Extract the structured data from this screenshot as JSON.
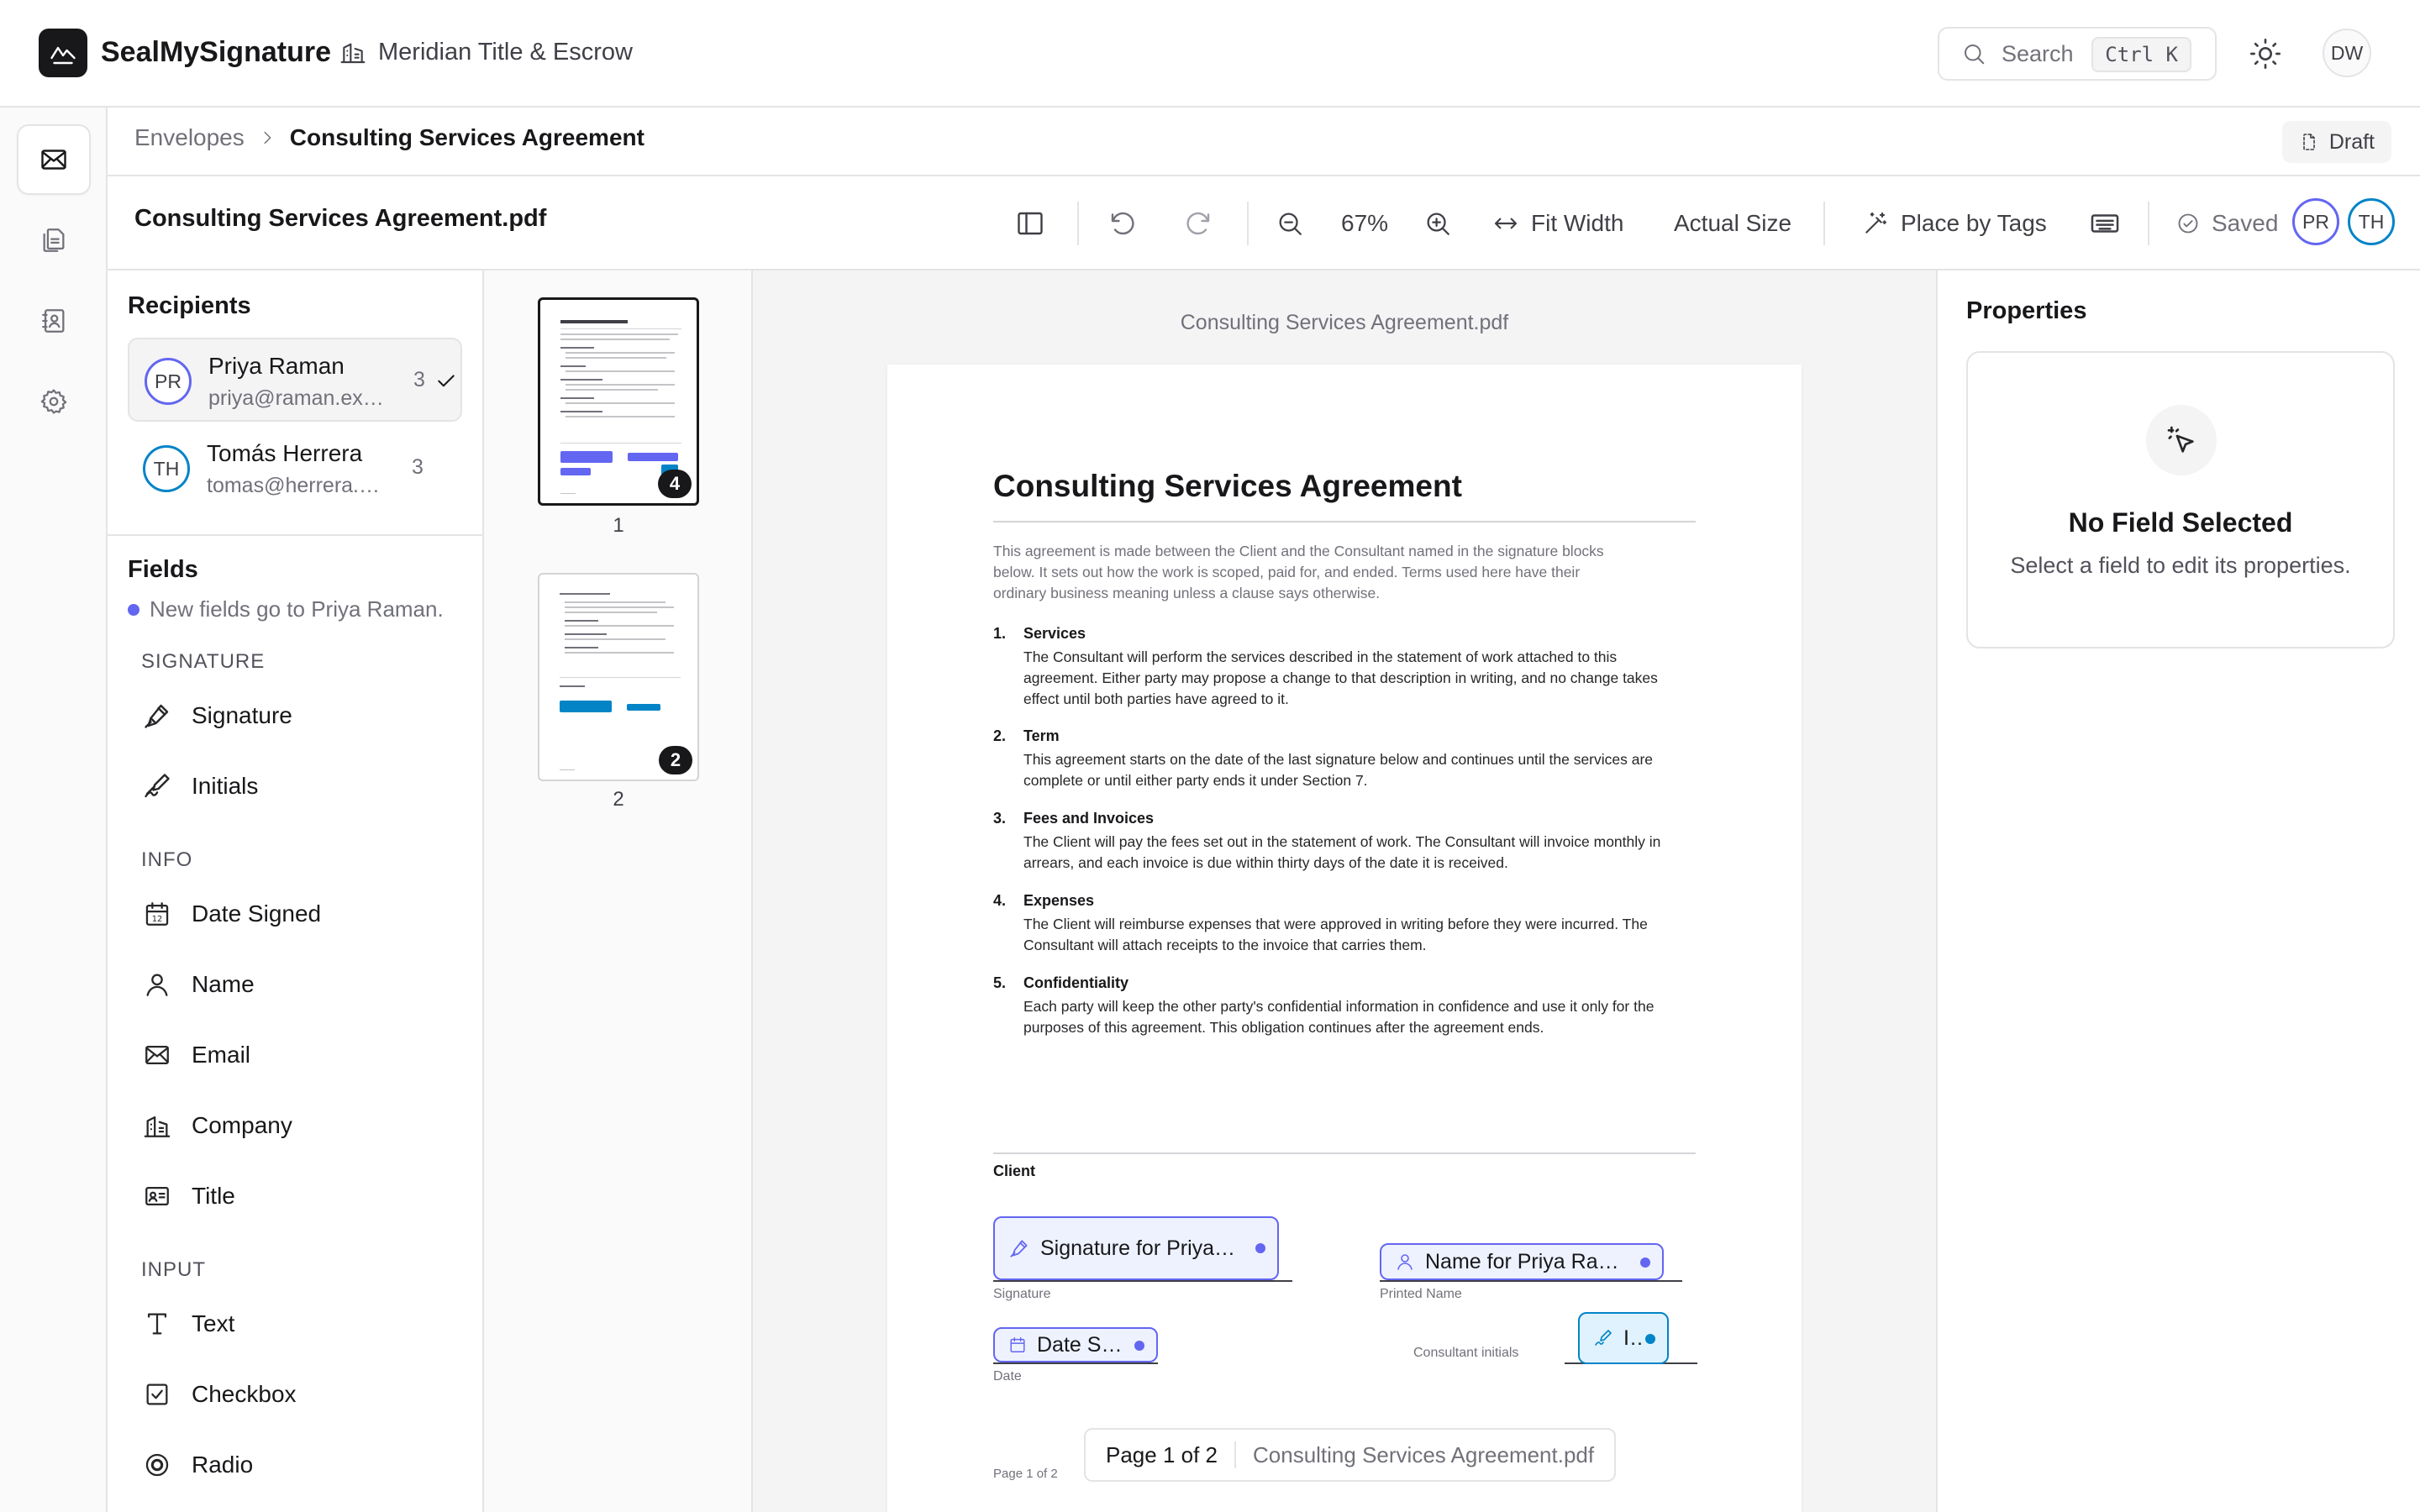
{
  "app": {
    "brand": "SealMySignature",
    "org": "Meridian Title & Escrow",
    "search_label": "Search",
    "search_shortcut": "Ctrl K",
    "user_initials": "DW",
    "accent_color": "#6366f1",
    "secondary_color": "#0284c7"
  },
  "rail": {
    "items": [
      {
        "icon": "envelope-icon",
        "active": true
      },
      {
        "icon": "documents-icon",
        "active": false
      },
      {
        "icon": "contacts-icon",
        "active": false
      },
      {
        "icon": "gear-icon",
        "active": false
      }
    ]
  },
  "breadcrumb": {
    "parent": "Envelopes",
    "current": "Consulting Services Agreement",
    "status": "Draft"
  },
  "toolbar": {
    "document_name": "Consulting Services Agreement.pdf",
    "zoom": "67%",
    "fit_width": "Fit Width",
    "actual_size": "Actual Size",
    "place_by_tags": "Place by Tags",
    "saved": "Saved",
    "avatars": [
      "PR",
      "TH"
    ]
  },
  "recipients": {
    "title": "Recipients",
    "items": [
      {
        "initials": "PR",
        "name": "Priya Raman",
        "email": "priya@raman.example",
        "count": "3",
        "selected": true,
        "color": "#6366f1"
      },
      {
        "initials": "TH",
        "name": "Tomás Herrera",
        "email": "tomas@herrera.example",
        "count": "3",
        "selected": false,
        "color": "#0284c7"
      }
    ]
  },
  "fields": {
    "title": "Fields",
    "hint": "New fields go to Priya Raman.",
    "groups": [
      {
        "label": "SIGNATURE",
        "items": [
          {
            "label": "Signature",
            "icon": "pen-icon"
          },
          {
            "label": "Initials",
            "icon": "initials-pen-icon"
          }
        ]
      },
      {
        "label": "INFO",
        "items": [
          {
            "label": "Date Signed",
            "icon": "calendar-icon"
          },
          {
            "label": "Name",
            "icon": "person-icon"
          },
          {
            "label": "Email",
            "icon": "mail-icon"
          },
          {
            "label": "Company",
            "icon": "building-icon"
          },
          {
            "label": "Title",
            "icon": "id-card-icon"
          }
        ]
      },
      {
        "label": "INPUT",
        "items": [
          {
            "label": "Text",
            "icon": "text-icon"
          },
          {
            "label": "Checkbox",
            "icon": "checkbox-icon"
          },
          {
            "label": "Radio",
            "icon": "radio-icon"
          }
        ]
      }
    ]
  },
  "thumbnails": [
    {
      "page": "1",
      "field_count": "4",
      "active": true
    },
    {
      "page": "2",
      "field_count": "2",
      "active": false
    }
  ],
  "document": {
    "file_label": "Consulting Services Agreement.pdf",
    "title": "Consulting Services Agreement",
    "intro": "This agreement is made between the Client and the Consultant named in the signature blocks below. It sets out how the work is scoped, paid for, and ended. Terms used here have their ordinary business meaning unless a clause says otherwise.",
    "clauses": [
      {
        "num": "1.",
        "heading": "Services",
        "body": "The Consultant will perform the services described in the statement of work attached to this agreement. Either party may propose a change to that description in writing, and no change takes effect until both parties have agreed to it."
      },
      {
        "num": "2.",
        "heading": "Term",
        "body": "This agreement starts on the date of the last signature below and continues until the services are complete or until either party ends it under Section 7."
      },
      {
        "num": "3.",
        "heading": "Fees and Invoices",
        "body": "The Client will pay the fees set out in the statement of work. The Consultant will invoice monthly in arrears, and each invoice is due within thirty days of the date it is received."
      },
      {
        "num": "4.",
        "heading": "Expenses",
        "body": "The Client will reimburse expenses that were approved in writing before they were incurred. The Consultant will attach receipts to the invoice that carries them."
      },
      {
        "num": "5.",
        "heading": "Confidentiality",
        "body": "Each party will keep the other party's confidential information in confidence and use it only for the purposes of this agreement. This obligation continues after the agreement ends."
      }
    ],
    "client_heading": "Client",
    "sig_labels": {
      "signature": "Signature",
      "printed_name": "Printed Name",
      "date": "Date",
      "consultant_initials": "Consultant initials"
    },
    "placed_fields": {
      "signature": "Signature for Priya Raman",
      "name": "Name for Priya Raman",
      "date": "Date Signed",
      "initials": "Initials"
    },
    "page_footer": "Page 1 of 2"
  },
  "pagebar": {
    "page": "Page 1 of 2",
    "file": "Consulting Services Agreement.pdf"
  },
  "properties": {
    "title": "Properties",
    "empty_heading": "No Field Selected",
    "empty_text": "Select a field to edit its properties."
  }
}
